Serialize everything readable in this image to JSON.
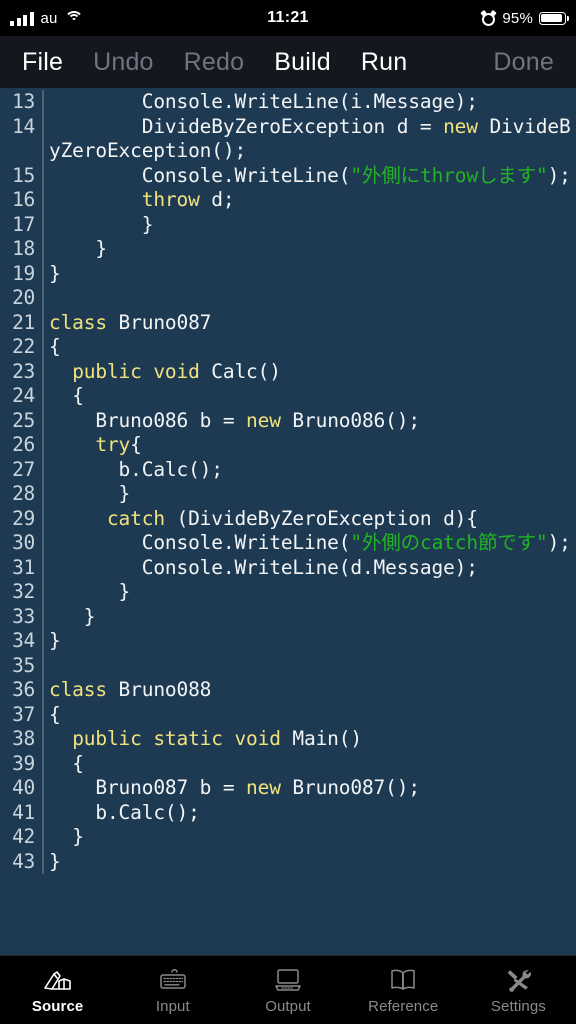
{
  "statusbar": {
    "carrier": "au",
    "time": "11:21",
    "battery_percent": "95%",
    "signal_icon": "signal-bars-icon",
    "wifi_icon": "wifi-icon",
    "alarm_icon": "alarm-clock-icon",
    "battery_icon": "battery-icon",
    "battery_level": 95
  },
  "toolbar": {
    "items": [
      {
        "label": "File",
        "enabled": true
      },
      {
        "label": "Undo",
        "enabled": false
      },
      {
        "label": "Redo",
        "enabled": false
      },
      {
        "label": "Build",
        "enabled": true
      },
      {
        "label": "Run",
        "enabled": true
      }
    ],
    "done_label": "Done",
    "done_enabled": false
  },
  "editor": {
    "language": "csharp",
    "colors": {
      "background": "#1d3a52",
      "text": "#f2f4f6",
      "keyword": "#f0e27e",
      "string": "#22b422",
      "line_number": "#c9d4dc",
      "gutter_rule": "#4d6476"
    },
    "first_visible_line": 13,
    "last_visible_line": 43,
    "lines": [
      {
        "n": "13",
        "tokens": [
          {
            "t": "        Console.WriteLine(i.Message);",
            "c": "pln"
          }
        ]
      },
      {
        "n": "14",
        "tokens": [
          {
            "t": "        DivideByZeroException d = ",
            "c": "pln"
          },
          {
            "t": "new",
            "c": "kw"
          },
          {
            "t": " DivideByZeroException();",
            "c": "pln"
          }
        ]
      },
      {
        "n": "15",
        "tokens": [
          {
            "t": "        Console.WriteLine(",
            "c": "pln"
          },
          {
            "t": "\"外側にthrowします\"",
            "c": "str"
          },
          {
            "t": ");",
            "c": "pln"
          }
        ]
      },
      {
        "n": "16",
        "tokens": [
          {
            "t": "        ",
            "c": "pln"
          },
          {
            "t": "throw",
            "c": "kw"
          },
          {
            "t": " d;",
            "c": "pln"
          }
        ]
      },
      {
        "n": "17",
        "tokens": [
          {
            "t": "        }",
            "c": "pln"
          }
        ]
      },
      {
        "n": "18",
        "tokens": [
          {
            "t": "    }",
            "c": "pln"
          }
        ]
      },
      {
        "n": "19",
        "tokens": [
          {
            "t": "}",
            "c": "pln"
          }
        ]
      },
      {
        "n": "20",
        "tokens": [
          {
            "t": "",
            "c": "pln"
          }
        ]
      },
      {
        "n": "21",
        "tokens": [
          {
            "t": "class",
            "c": "kw"
          },
          {
            "t": " Bruno087",
            "c": "pln"
          }
        ]
      },
      {
        "n": "22",
        "tokens": [
          {
            "t": "{",
            "c": "pln"
          }
        ]
      },
      {
        "n": "23",
        "tokens": [
          {
            "t": "  ",
            "c": "pln"
          },
          {
            "t": "public void",
            "c": "kw"
          },
          {
            "t": " Calc()",
            "c": "pln"
          }
        ]
      },
      {
        "n": "24",
        "tokens": [
          {
            "t": "  {",
            "c": "pln"
          }
        ]
      },
      {
        "n": "25",
        "tokens": [
          {
            "t": "    Bruno086 b = ",
            "c": "pln"
          },
          {
            "t": "new",
            "c": "kw"
          },
          {
            "t": " Bruno086();",
            "c": "pln"
          }
        ]
      },
      {
        "n": "26",
        "tokens": [
          {
            "t": "    ",
            "c": "pln"
          },
          {
            "t": "try",
            "c": "kw"
          },
          {
            "t": "{",
            "c": "pln"
          }
        ]
      },
      {
        "n": "27",
        "tokens": [
          {
            "t": "      b.Calc();",
            "c": "pln"
          }
        ]
      },
      {
        "n": "28",
        "tokens": [
          {
            "t": "      }",
            "c": "pln"
          }
        ]
      },
      {
        "n": "29",
        "tokens": [
          {
            "t": "     ",
            "c": "pln"
          },
          {
            "t": "catch",
            "c": "kw"
          },
          {
            "t": " (DivideByZeroException d){",
            "c": "pln"
          }
        ]
      },
      {
        "n": "30",
        "tokens": [
          {
            "t": "        Console.WriteLine(",
            "c": "pln"
          },
          {
            "t": "\"外側のcatch節です\"",
            "c": "str"
          },
          {
            "t": ");",
            "c": "pln"
          }
        ]
      },
      {
        "n": "31",
        "tokens": [
          {
            "t": "        Console.WriteLine(d.Message);",
            "c": "pln"
          }
        ]
      },
      {
        "n": "32",
        "tokens": [
          {
            "t": "      }",
            "c": "pln"
          }
        ]
      },
      {
        "n": "33",
        "tokens": [
          {
            "t": "   }",
            "c": "pln"
          }
        ]
      },
      {
        "n": "34",
        "tokens": [
          {
            "t": "}",
            "c": "pln"
          }
        ]
      },
      {
        "n": "35",
        "tokens": [
          {
            "t": "",
            "c": "pln"
          }
        ]
      },
      {
        "n": "36",
        "tokens": [
          {
            "t": "class",
            "c": "kw"
          },
          {
            "t": " Bruno088",
            "c": "pln"
          }
        ]
      },
      {
        "n": "37",
        "tokens": [
          {
            "t": "{",
            "c": "pln"
          }
        ]
      },
      {
        "n": "38",
        "tokens": [
          {
            "t": "  ",
            "c": "pln"
          },
          {
            "t": "public static void",
            "c": "kw"
          },
          {
            "t": " Main()",
            "c": "pln"
          }
        ]
      },
      {
        "n": "39",
        "tokens": [
          {
            "t": "  {",
            "c": "pln"
          }
        ]
      },
      {
        "n": "40",
        "tokens": [
          {
            "t": "    Bruno087 b = ",
            "c": "pln"
          },
          {
            "t": "new",
            "c": "kw"
          },
          {
            "t": " Bruno087();",
            "c": "pln"
          }
        ]
      },
      {
        "n": "41",
        "tokens": [
          {
            "t": "    b.Calc();",
            "c": "pln"
          }
        ]
      },
      {
        "n": "42",
        "tokens": [
          {
            "t": "  }",
            "c": "pln"
          }
        ]
      },
      {
        "n": "43",
        "tokens": [
          {
            "t": "}",
            "c": "pln"
          }
        ]
      }
    ]
  },
  "tabbar": {
    "items": [
      {
        "label": "Source",
        "icon": "writing-hand-icon",
        "active": true
      },
      {
        "label": "Input",
        "icon": "keyboard-icon",
        "active": false
      },
      {
        "label": "Output",
        "icon": "computer-icon",
        "active": false
      },
      {
        "label": "Reference",
        "icon": "open-book-icon",
        "active": false
      },
      {
        "label": "Settings",
        "icon": "tools-icon",
        "active": false
      }
    ]
  }
}
